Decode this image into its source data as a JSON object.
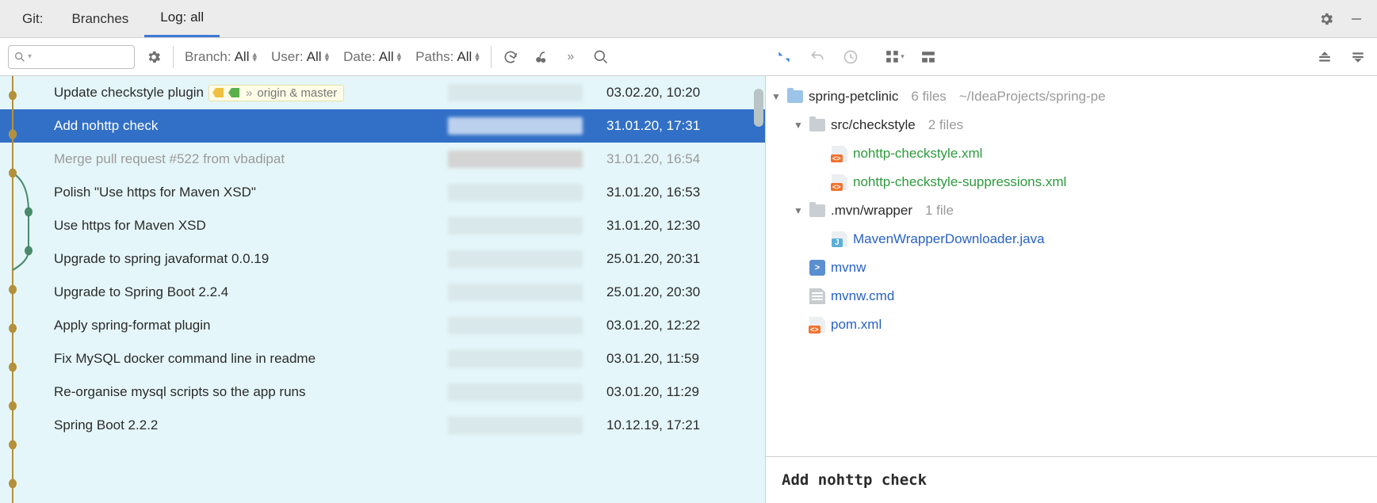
{
  "tabbar": {
    "title": "Git:",
    "tabs": [
      {
        "label": "Branches",
        "active": false
      },
      {
        "label": "Log: all",
        "active": true
      }
    ]
  },
  "filters": {
    "branch": {
      "label": "Branch:",
      "value": "All"
    },
    "user": {
      "label": "User:",
      "value": "All"
    },
    "date": {
      "label": "Date:",
      "value": "All"
    },
    "paths": {
      "label": "Paths:",
      "value": "All"
    }
  },
  "branch_tag": "origin & master",
  "commits": [
    {
      "message": "Update checkstyle plugin",
      "date": "03.02.20, 10:20",
      "selected": false,
      "dim": false,
      "has_tag": true
    },
    {
      "message": "Add nohttp check",
      "date": "31.01.20, 17:31",
      "selected": true,
      "dim": false
    },
    {
      "message": "Merge pull request #522 from vbadipat",
      "date": "31.01.20, 16:54",
      "selected": false,
      "dim": true
    },
    {
      "message": "Polish \"Use https for Maven XSD\"",
      "date": "31.01.20, 16:53",
      "selected": false,
      "dim": false
    },
    {
      "message": "Use https for Maven XSD",
      "date": "31.01.20, 12:30",
      "selected": false,
      "dim": false
    },
    {
      "message": "Upgrade to spring javaformat 0.0.19",
      "date": "25.01.20, 20:31",
      "selected": false,
      "dim": false
    },
    {
      "message": "Upgrade to Spring Boot 2.2.4",
      "date": "25.01.20, 20:30",
      "selected": false,
      "dim": false
    },
    {
      "message": "Apply spring-format plugin",
      "date": "03.01.20, 12:22",
      "selected": false,
      "dim": false
    },
    {
      "message": "Fix MySQL docker command line in readme",
      "date": "03.01.20, 11:59",
      "selected": false,
      "dim": false
    },
    {
      "message": "Re-organise mysql scripts so the app runs",
      "date": "03.01.20, 11:29",
      "selected": false,
      "dim": false
    },
    {
      "message": "Spring Boot 2.2.2",
      "date": "10.12.19, 17:21",
      "selected": false,
      "dim": false
    }
  ],
  "file_tree": {
    "root": {
      "name": "spring-petclinic",
      "count": "6 files",
      "path": "~/IdeaProjects/spring-pe"
    },
    "folders": [
      {
        "name": "src/checkstyle",
        "count": "2 files",
        "files": [
          {
            "name": "nohttp-checkstyle.xml",
            "type": "xml",
            "color": "green"
          },
          {
            "name": "nohttp-checkstyle-suppressions.xml",
            "type": "xml",
            "color": "green"
          }
        ]
      },
      {
        "name": ".mvn/wrapper",
        "count": "1 file",
        "files": [
          {
            "name": "MavenWrapperDownloader.java",
            "type": "java",
            "color": "blue"
          }
        ]
      }
    ],
    "root_files": [
      {
        "name": "mvnw",
        "type": "sh",
        "color": "blue"
      },
      {
        "name": "mvnw.cmd",
        "type": "txt",
        "color": "blue"
      },
      {
        "name": "pom.xml",
        "type": "xml",
        "color": "blue"
      }
    ]
  },
  "commit_detail": {
    "title": "Add nohttp check"
  }
}
